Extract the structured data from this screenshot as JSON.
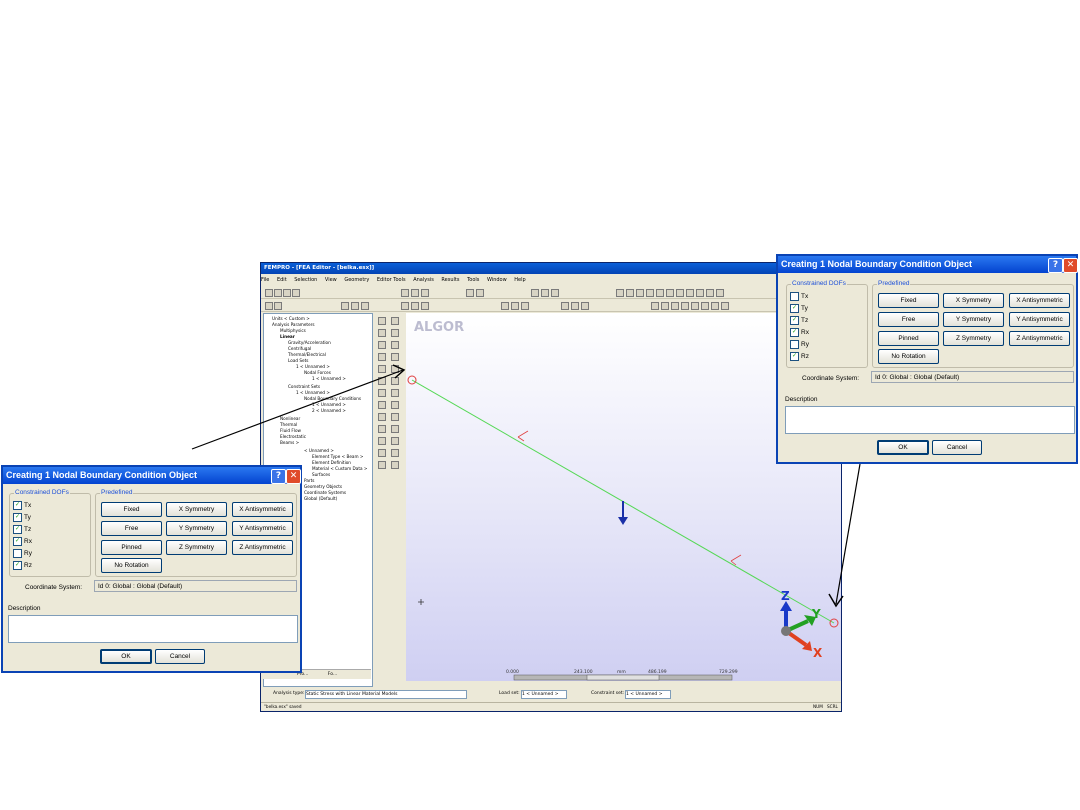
{
  "app": {
    "title": "FEMPRO - [FEA Editor - [belka.esx]]",
    "menu": [
      "File",
      "Edit",
      "Selection",
      "View",
      "Geometry",
      "Editor Tools",
      "Analysis",
      "Results",
      "Tools",
      "Window",
      "Help"
    ],
    "tree": [
      "Units < Custom >",
      "Analysis Parameters",
      "Multiphysics",
      "Linear",
      "Gravity/Acceleration",
      "Centrifugal",
      "Thermal/Electrical",
      "Load Sets",
      "1 < Unnamed >",
      "Nodal Forces",
      "1 < Unnamed >",
      "Constraint Sets",
      "1 < Unnamed >",
      "Nodal Boundary Conditions",
      "1 < Unnamed >",
      "2 < Unnamed >",
      "Nonlinear",
      "Thermal",
      "Fluid Flow",
      "Electrostatic",
      "Beams >",
      "< Unnamed >",
      "Element Type < Beam >",
      "Element Definition",
      "Material < Custom Data >",
      "Surfaces",
      "Parts",
      "Geometry Objects",
      "Coordinate Systems",
      "Global (Default)"
    ],
    "tree_tabs": [
      "Pro...",
      "Fo..."
    ],
    "viewport": {
      "logo": "ALGOR",
      "axis": {
        "z": "Z",
        "y": "Y",
        "x": "X"
      },
      "scale": {
        "t0": "0.000",
        "t1": "243.100",
        "unit": "mm",
        "t2": "486.199",
        "t3": "729.299"
      }
    },
    "status": {
      "analysis_label": "Analysis type:",
      "analysis_value": "Static Stress with Linear Material Models",
      "loadset_label": "Load set:",
      "loadset_value": "1 < Unnamed >",
      "constraint_label": "Constraint set:",
      "constraint_value": "1 < Unnamed >",
      "message": "\"belka.esx\" saved",
      "num": "NUM",
      "scrl": "SCRL"
    }
  },
  "dialog": {
    "title": "Creating 1 Nodal Boundary Condition Object",
    "constrained_label": "Constrained DOFs",
    "predefined_label": "Predefined",
    "dofs": [
      {
        "label": "Tx",
        "checked": true
      },
      {
        "label": "Ty",
        "checked": true
      },
      {
        "label": "Tz",
        "checked": true
      },
      {
        "label": "Rx",
        "checked": true
      },
      {
        "label": "Ry",
        "checked": false
      },
      {
        "label": "Rz",
        "checked": true
      }
    ],
    "dofs_right": [
      {
        "label": "Tx",
        "checked": false
      },
      {
        "label": "Ty",
        "checked": true
      },
      {
        "label": "Tz",
        "checked": true
      },
      {
        "label": "Rx",
        "checked": true
      },
      {
        "label": "Ry",
        "checked": false
      },
      {
        "label": "Rz",
        "checked": true
      }
    ],
    "buttons": [
      "Fixed",
      "X Symmetry",
      "X Antisymmetric",
      "Free",
      "Y Symmetry",
      "Y Antisymmetric",
      "Pinned",
      "Z Symmetry",
      "Z Antisymmetric",
      "No Rotation"
    ],
    "coord_label": "Coordinate System:",
    "coord_value": "Id 0: Global : Global (Default)",
    "desc_label": "Description",
    "ok": "OK",
    "cancel": "Cancel"
  },
  "colors": {
    "title_bar": "#0343d0",
    "beam": "#55d855",
    "load_arrow": "#1a2fa8"
  }
}
